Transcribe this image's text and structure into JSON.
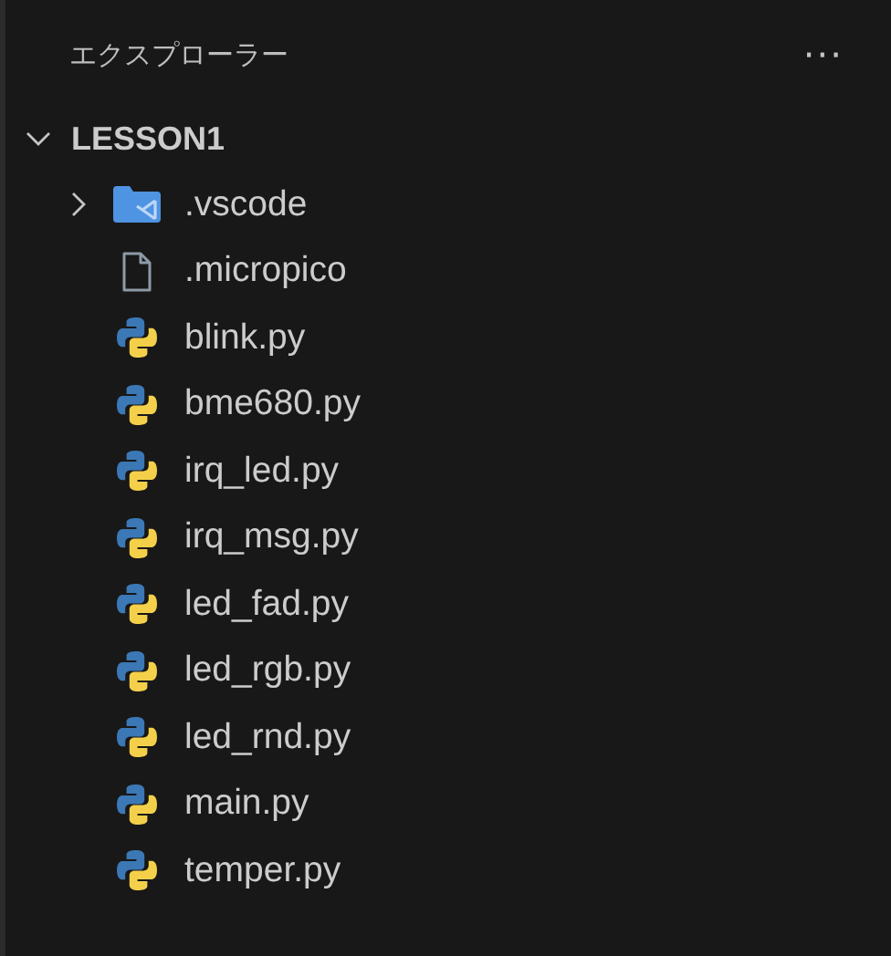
{
  "panel": {
    "title": "エクスプローラー",
    "more": "···"
  },
  "folder": {
    "name": "LESSON1",
    "expanded": true
  },
  "items": [
    {
      "name": ".vscode",
      "kind": "vscode-folder",
      "expanded": false
    },
    {
      "name": ".micropico",
      "kind": "file"
    },
    {
      "name": "blink.py",
      "kind": "python"
    },
    {
      "name": "bme680.py",
      "kind": "python"
    },
    {
      "name": "irq_led.py",
      "kind": "python"
    },
    {
      "name": "irq_msg.py",
      "kind": "python"
    },
    {
      "name": "led_fad.py",
      "kind": "python"
    },
    {
      "name": "led_rgb.py",
      "kind": "python"
    },
    {
      "name": "led_rnd.py",
      "kind": "python"
    },
    {
      "name": "main.py",
      "kind": "python"
    },
    {
      "name": "temper.py",
      "kind": "python"
    }
  ]
}
